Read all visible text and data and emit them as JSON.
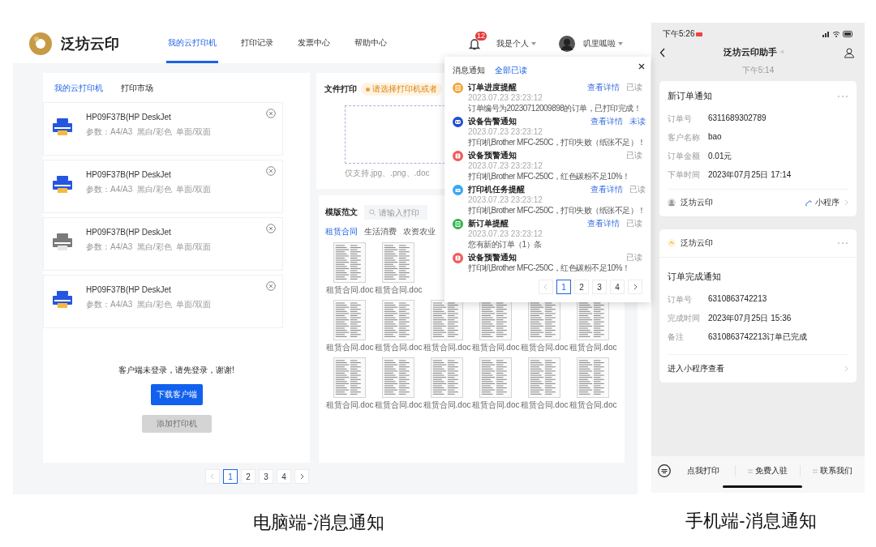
{
  "desktop": {
    "header": {
      "brand": "泛坊云印",
      "nav": [
        {
          "label": "我的云打印机",
          "selected": true
        },
        {
          "label": "打印记录",
          "selected": false
        },
        {
          "label": "发票中心",
          "selected": false
        },
        {
          "label": "帮助中心",
          "selected": false
        }
      ],
      "bell_badge": "12",
      "account": "我是个人",
      "user": "叽里呱啦"
    },
    "printer_panel": {
      "tabs": [
        {
          "label": "我的云打印机",
          "selected": true
        },
        {
          "label": "打印市场",
          "selected": false
        }
      ],
      "printers": [
        {
          "name": "HP09F37B(HP DeskJet",
          "params": "参数：A4/A3  黑白/彩色  单面/双面",
          "online": true
        },
        {
          "name": "HP09F37B(HP DeskJet",
          "params": "参数：A4/A3  黑白/彩色  单面/双面",
          "online": true
        },
        {
          "name": "HP09F37B(HP DeskJet",
          "params": "参数：A4/A3  黑白/彩色  单面/双面",
          "online": false
        },
        {
          "name": "HP09F37B(HP DeskJet",
          "params": "参数：A4/A3  黑白/彩色  单面/双面",
          "online": true
        }
      ],
      "login_notice": "客户端未登录，请先登录，谢谢!",
      "download_button": "下载客户端",
      "add_button": {
        "label": "添加打印机",
        "disabled": true
      }
    },
    "pager": [
      {
        "label": "1",
        "selected": true
      },
      {
        "label": "2",
        "selected": false
      },
      {
        "label": "3",
        "selected": false
      },
      {
        "label": "4",
        "selected": false
      }
    ],
    "file_print": {
      "title": "文件打印",
      "hint": "请选择打印机或者",
      "formats": "仅支持.jpg、.png、.doc"
    },
    "templates": {
      "title": "模版范文",
      "search_placeholder": "请输入打印",
      "categories": [
        {
          "label": "租赁合同",
          "selected": true
        },
        {
          "label": "生活消费",
          "selected": false
        },
        {
          "label": "农资农业",
          "selected": false
        }
      ],
      "rows": [
        [
          "租赁合同.doc",
          "租赁合同.doc"
        ],
        [
          "租赁合同.doc",
          "租赁合同.doc",
          "租赁合同.doc",
          "租赁合同.doc",
          "租赁合同.doc",
          "租赁合同.doc"
        ],
        [
          "租赁合同.doc",
          "租赁合同.doc",
          "租赁合同.doc",
          "租赁合同.doc",
          "租赁合同.doc",
          "租赁合同.doc"
        ]
      ]
    },
    "notifications": {
      "title": "消息通知",
      "mark_all": "全部已读",
      "items": [
        {
          "kind": "order",
          "color": "#f3a53a",
          "title": "订单进度提醒",
          "time": "2023.07.23 23:23:12",
          "link": "查看详情",
          "status": "已读",
          "read": true,
          "message": "订单编号为20230712009898的订单，已打印完成！"
        },
        {
          "kind": "device",
          "color": "#1f4fd8",
          "title": "设备告警通知",
          "time": "2023.07.23 23:23:12",
          "link": "查看详情",
          "status": "未读",
          "read": false,
          "message": "打印机Brother MFC-250C，打印失败（纸张不足）！"
        },
        {
          "kind": "warning",
          "color": "#ee5b5b",
          "title": "设备预警通知",
          "time": "2023.07.23 23:23:12",
          "status": "已读",
          "read": true,
          "message": "打印机Brother MFC-250C，红色碳粉不足10%！"
        },
        {
          "kind": "task",
          "color": "#38a8f2",
          "title": "打印机任务提醒",
          "time": "2023.07.23 23:23:12",
          "link": "查看详情",
          "status": "已读",
          "read": true,
          "message": "打印机Brother MFC-250C，打印失败（纸张不足）！"
        },
        {
          "kind": "order",
          "color": "#2eb24c",
          "title": "新订单提醒",
          "time": "2023.07.23 23:23:12",
          "link": "查看详情",
          "status": "已读",
          "read": true,
          "message": "您有新的订单（1）条"
        },
        {
          "kind": "warning",
          "color": "#ee5b5b",
          "title": "设备预警通知",
          "status": "已读",
          "read": true,
          "message": "打印机Brother MFC-250C，红色碳粉不足10%！"
        }
      ],
      "pager": [
        {
          "label": "1",
          "selected": true
        },
        {
          "label": "2",
          "selected": false
        },
        {
          "label": "3",
          "selected": false
        },
        {
          "label": "4",
          "selected": false
        }
      ]
    },
    "caption": "电脑端-消息通知"
  },
  "phone": {
    "status_time": "下午5:26",
    "title": "泛坊云印助手",
    "timestamp": "下午5:14",
    "cards": [
      {
        "title": "新订单通知",
        "fields": [
          {
            "label": "订单号",
            "value": "6311689302789"
          },
          {
            "label": "客户名称",
            "value": "bao"
          },
          {
            "label": "订单金额",
            "value": "0.01元"
          },
          {
            "label": "下单时间",
            "value": "2023年07月25日 17:14"
          }
        ],
        "footer_account": "泛坊云印",
        "footer_link": "小程序"
      },
      {
        "header_account": "泛坊云印",
        "title": "订单完成通知",
        "fields": [
          {
            "label": "订单号",
            "value": "6310863742213"
          },
          {
            "label": "完成时间",
            "value": "2023年07月25日 15:36"
          },
          {
            "label": "备注",
            "value": "6310863742213订单已完成"
          }
        ],
        "action": "进入小程序查看"
      }
    ],
    "menu": [
      "点我打印",
      "免费入驻",
      "联系我们"
    ],
    "caption": "手机端-消息通知"
  }
}
